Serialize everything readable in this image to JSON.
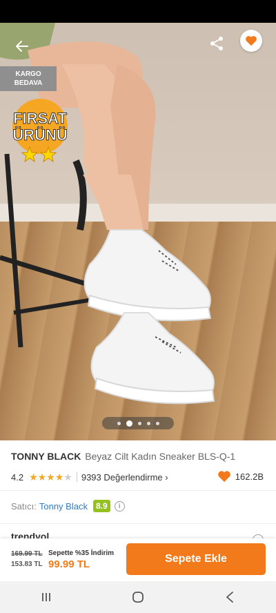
{
  "hero": {
    "image_alt": "white chunky sneakers on legs",
    "carousel_total": 5,
    "carousel_active": 1
  },
  "badges": {
    "shipping_line1": "KARGO",
    "shipping_line2": "BEDAVA",
    "deal_line1": "FIRSAT",
    "deal_line2": "ÜRÜNÜ"
  },
  "product": {
    "brand": "TONNY BLACK",
    "name": "Beyaz Cilt Kadın  Sneaker BLS-Q-1",
    "rating": "4.2",
    "stars": 4,
    "reviews": "9393 Değerlendirme",
    "favorites": "162.2B"
  },
  "seller": {
    "label": "Satıcı:",
    "name": "Tonny Black",
    "score": "8.9"
  },
  "peek": {
    "text": "trendyol"
  },
  "pricing": {
    "old_price": "169.99 TL",
    "mid_price": "153.83 TL",
    "promo": "Sepette %35 İndirim",
    "final_price": "99.99 TL",
    "cta": "Sepete Ekle"
  },
  "colors": {
    "accent": "#f27a1a",
    "seller_score": "#94c11f",
    "link": "#2b7dc4"
  },
  "icons": [
    "back-arrow-icon",
    "share-icon",
    "heart-icon",
    "info-icon",
    "recents-icon",
    "home-icon",
    "back-icon"
  ]
}
